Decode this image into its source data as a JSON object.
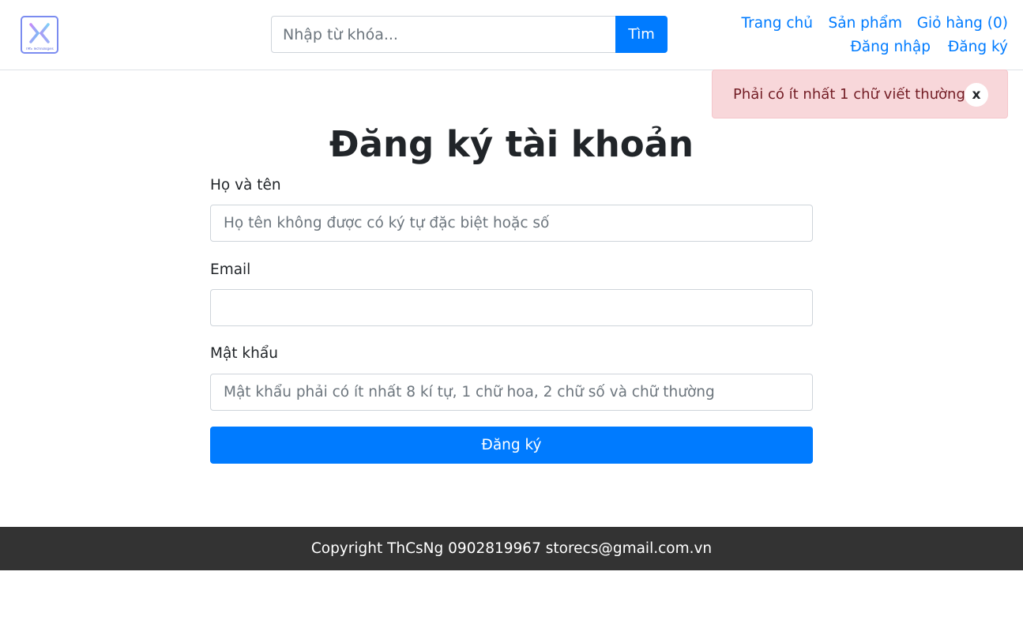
{
  "header": {
    "logo_text": "TMS Technologies",
    "search": {
      "placeholder": "Nhập từ khóa...",
      "value": "",
      "button_label": "Tìm"
    },
    "nav": {
      "home": "Trang chủ",
      "products": "Sản phẩm",
      "cart": "Giỏ hàng (0)",
      "login": "Đăng nhập",
      "register": "Đăng ký"
    }
  },
  "alert": {
    "message": "Phải có ít nhất 1 chữ viết thường",
    "close_label": "x"
  },
  "form": {
    "title": "Đăng ký tài khoản",
    "name_label": "Họ và tên",
    "name_placeholder": "Họ tên không được có ký tự đặc biệt hoặc số",
    "name_value": "",
    "email_label": "Email",
    "email_placeholder": "",
    "email_value": "",
    "password_label": "Mật khẩu",
    "password_placeholder": "Mật khẩu phải có ít nhất 8 kí tự, 1 chữ hoa, 2 chữ số và chữ thường",
    "password_value": "",
    "submit_label": "Đăng ký"
  },
  "footer": {
    "text": "Copyright ThCsNg 0902819967 storecs@gmail.com.vn"
  },
  "colors": {
    "primary": "#007bff",
    "alert_bg": "#f8d7da",
    "alert_text": "#721c24",
    "footer_bg": "#333333"
  }
}
